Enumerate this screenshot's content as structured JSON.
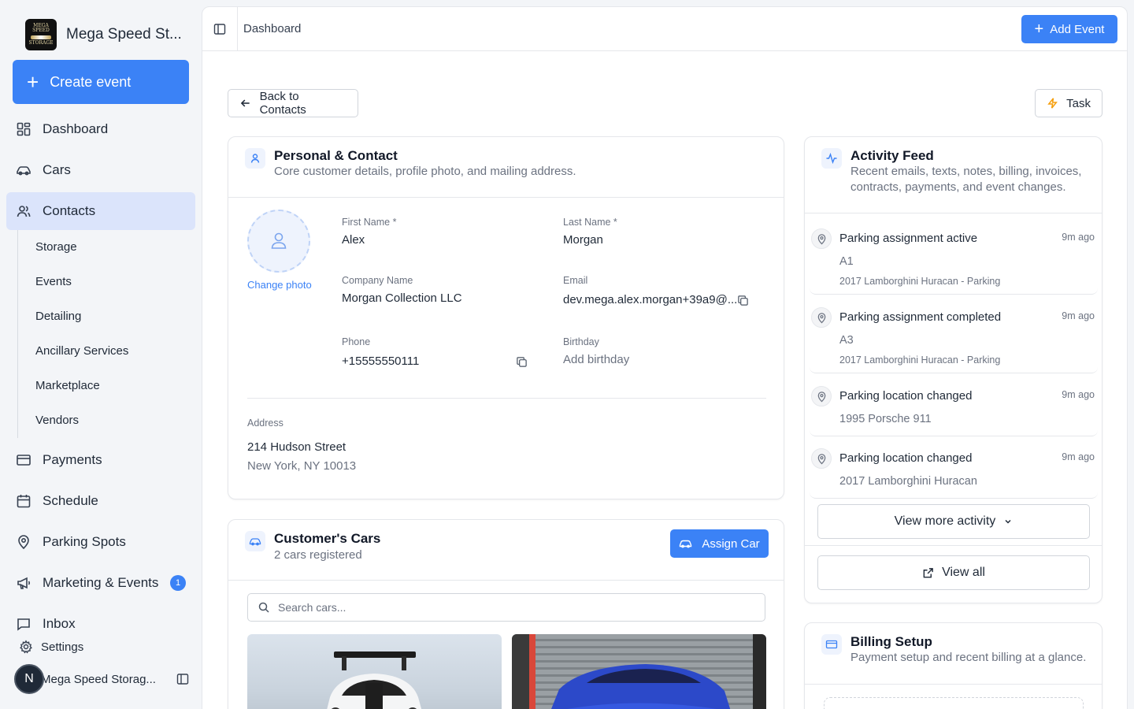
{
  "sidebar": {
    "brand_name": "Mega Speed St...",
    "logo_text_top": "MEGA SPEED",
    "logo_text_bottom": "STORAGE",
    "create_label": "Create event",
    "nav": {
      "dashboard": "Dashboard",
      "cars": "Cars",
      "contacts": "Contacts",
      "payments": "Payments",
      "schedule": "Schedule",
      "parking": "Parking Spots",
      "marketing": "Marketing & Events",
      "marketing_badge": "1",
      "inbox": "Inbox"
    },
    "subnav": [
      "Storage",
      "Events",
      "Detailing",
      "Ancillary Services",
      "Marketplace",
      "Vendors"
    ],
    "settings": "Settings",
    "user_initial": "N",
    "user_name": "Mega Speed Storag..."
  },
  "topbar": {
    "breadcrumb": "Dashboard",
    "add_event": "Add Event"
  },
  "actions": {
    "back": "Back to Contacts",
    "task": "Task"
  },
  "personal": {
    "title": "Personal & Contact",
    "subtitle": "Core customer details, profile photo, and mailing address.",
    "change_photo": "Change photo",
    "first_name_label": "First Name *",
    "first_name": "Alex",
    "last_name_label": "Last Name *",
    "last_name": "Morgan",
    "company_label": "Company Name",
    "company": "Morgan Collection LLC",
    "email_label": "Email",
    "email": "dev.mega.alex.morgan+39a9@...",
    "phone_label": "Phone",
    "phone": "+15555550111",
    "birthday_label": "Birthday",
    "birthday": "Add birthday",
    "address_label": "Address",
    "address_line1": "214 Hudson Street",
    "address_line2": "New York, NY 10013"
  },
  "cars": {
    "title": "Customer's Cars",
    "subtitle": "2 cars registered",
    "assign": "Assign Car",
    "search_placeholder": "Search cars..."
  },
  "activity": {
    "title": "Activity Feed",
    "subtitle_1": "Recent emails, texts, notes, billing, invoices,",
    "subtitle_2": "contracts, payments, and event changes.",
    "items": [
      {
        "title": "Parking assignment active",
        "time": "9m ago",
        "line1": "A1",
        "line2": "2017 Lamborghini Huracan - Parking"
      },
      {
        "title": "Parking assignment completed",
        "time": "9m ago",
        "line1": "A3",
        "line2": "2017 Lamborghini Huracan - Parking"
      },
      {
        "title": "Parking location changed",
        "time": "9m ago",
        "line1": "1995 Porsche 911"
      },
      {
        "title": "Parking location changed",
        "time": "9m ago",
        "line1": "2017 Lamborghini Huracan"
      }
    ],
    "view_more": "View more activity",
    "view_all": "View all"
  },
  "billing": {
    "title": "Billing Setup",
    "subtitle": "Payment setup and recent billing at a glance."
  },
  "colors": {
    "accent": "#3b82f6",
    "active_nav": "#dbe4fb"
  }
}
